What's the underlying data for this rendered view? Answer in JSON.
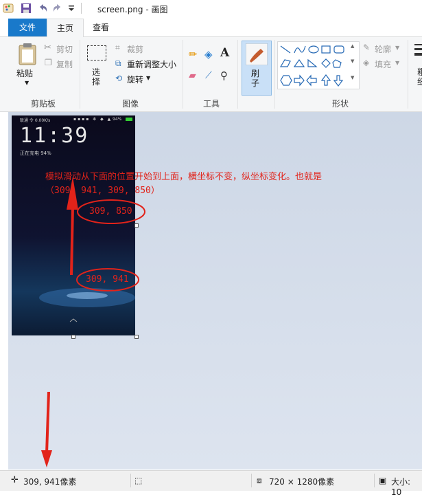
{
  "window": {
    "title": "screen.png - 画图"
  },
  "tabs": [
    {
      "label": "文件"
    },
    {
      "label": "主页"
    },
    {
      "label": "查看"
    }
  ],
  "ribbon": {
    "clipboard": {
      "paste": "粘贴",
      "cut": "剪切",
      "copy": "复制",
      "group": "剪贴板"
    },
    "image": {
      "select": "选择",
      "crop": "裁剪",
      "resize": "重新调整大小",
      "rotate": "旋转",
      "group": "图像"
    },
    "tools": {
      "text_glyph": "A",
      "group": "工具"
    },
    "brushes": {
      "label": "刷子"
    },
    "shapes": {
      "outline": "轮廓",
      "fill": "填充",
      "group": "形状"
    },
    "overflow_label": "粗细"
  },
  "screenshot_content": {
    "time": "11:39",
    "charging": "正在充电 94%",
    "status_left": "联通 令 0.00K/s",
    "status_right": "94%"
  },
  "annotation": {
    "line1": "模拟滑动从下面的位置开始到上面，横坐标不变，纵坐标变化。也就是",
    "line2": "（309, 941, 309, 850）",
    "top_point": "309, 850",
    "bottom_point": "309, 941",
    "color": "#e2231a"
  },
  "status": {
    "cursor": "309, 941像素",
    "dimensions": "720 × 1280像素",
    "size": "大小: 10"
  }
}
